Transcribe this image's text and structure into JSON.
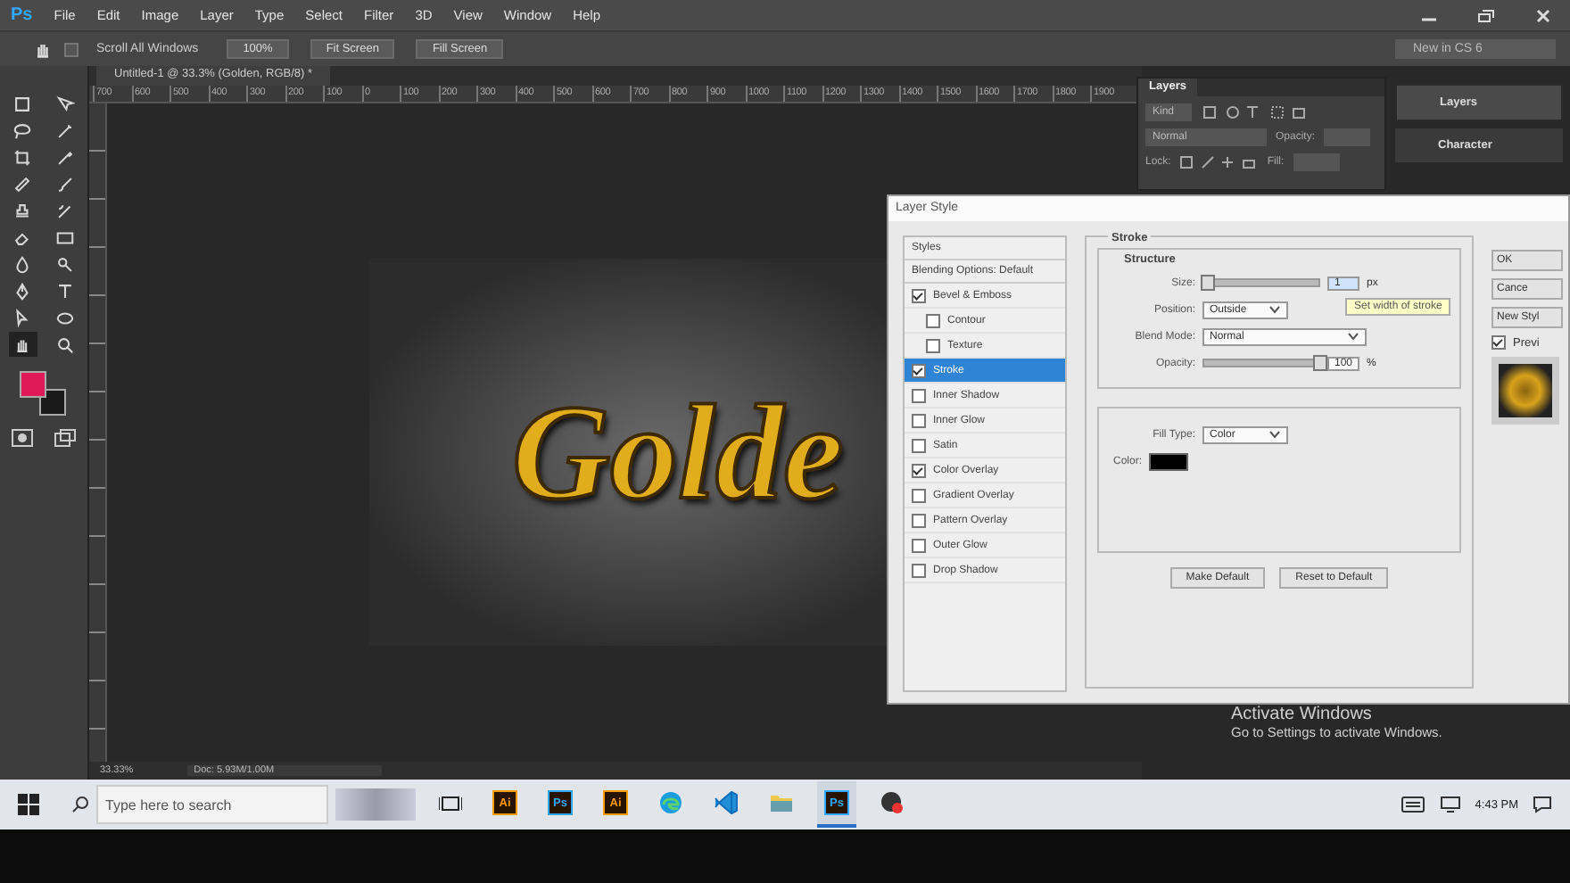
{
  "app": {
    "logo": "Ps"
  },
  "menu": [
    "File",
    "Edit",
    "Image",
    "Layer",
    "Type",
    "Select",
    "Filter",
    "3D",
    "View",
    "Window",
    "Help"
  ],
  "options_bar": {
    "scroll_all": {
      "label": "Scroll All Windows",
      "checked": false
    },
    "buttons": [
      "100%",
      "Fit Screen",
      "Fill Screen"
    ],
    "workspace": "New in CS 6"
  },
  "tools": [
    {
      "selected": false
    },
    {
      "selected": false
    },
    {
      "selected": false
    },
    {
      "selected": false
    },
    {
      "selected": false
    },
    {
      "selected": false
    },
    {
      "selected": false
    },
    {
      "selected": false
    },
    {
      "selected": false
    },
    {
      "selected": false
    },
    {
      "selected": false
    },
    {
      "selected": false
    },
    {
      "selected": false
    },
    {
      "selected": false
    },
    {
      "selected": false
    },
    {
      "selected": false
    },
    {
      "selected": false
    },
    {
      "selected": false
    },
    {
      "selected": true
    },
    {
      "selected": false
    }
  ],
  "swatches": [
    {
      "color": "#e0195a"
    },
    {
      "color": "#1a1a1a"
    }
  ],
  "document": {
    "tab": "Untitled-1 @ 33.3% (Golden, RGB/8) *",
    "ruler": [
      "700",
      "600",
      "500",
      "400",
      "300",
      "200",
      "100",
      "0",
      "100",
      "200",
      "300",
      "400",
      "500",
      "600",
      "700",
      "800",
      "900",
      "1000",
      "1100",
      "1200",
      "1300",
      "1400",
      "1500",
      "1600",
      "1700",
      "1800",
      "1900"
    ],
    "canvas_text": "Golde",
    "zoom": "33.33%",
    "doc_info": "Doc: 5.93M/1.00M"
  },
  "layers_panel": {
    "tab": "Layers",
    "filter": "Kind",
    "blend_mode": "Normal",
    "opacity_label": "Opacity:",
    "lock_label": "Lock:",
    "fill_label": "Fill:"
  },
  "dock": [
    {
      "label": "Layers",
      "selected": true
    },
    {
      "label": "Character",
      "selected": false
    }
  ],
  "dialog": {
    "title": "Layer Style",
    "styles_header": "Styles",
    "blending": "Blending Options: Default",
    "effects": [
      {
        "label": "Bevel & Emboss",
        "checked": true,
        "selected": false,
        "children": [
          {
            "label": "Contour",
            "checked": false,
            "selected": false
          },
          {
            "label": "Texture",
            "checked": false,
            "selected": false
          }
        ]
      },
      {
        "label": "Stroke",
        "checked": true,
        "selected": true
      },
      {
        "label": "Inner Shadow",
        "checked": false,
        "selected": false
      },
      {
        "label": "Inner Glow",
        "checked": false,
        "selected": false
      },
      {
        "label": "Satin",
        "checked": false,
        "selected": false
      },
      {
        "label": "Color Overlay",
        "checked": true,
        "selected": false
      },
      {
        "label": "Gradient Overlay",
        "checked": false,
        "selected": false
      },
      {
        "label": "Pattern Overlay",
        "checked": false,
        "selected": false
      },
      {
        "label": "Outer Glow",
        "checked": false,
        "selected": false
      },
      {
        "label": "Drop Shadow",
        "checked": false,
        "selected": false
      }
    ],
    "group_title": "Stroke",
    "structure_title": "Structure",
    "size": {
      "label": "Size:",
      "level": 0.02,
      "value": "1",
      "unit": "px"
    },
    "position": {
      "label": "Position:",
      "value": "Outside"
    },
    "blend_mode": {
      "label": "Blend Mode:",
      "value": "Normal"
    },
    "opacity": {
      "label": "Opacity:",
      "level": 1,
      "value": "100",
      "unit": "%"
    },
    "tooltip": "Set width of stroke",
    "fill_type": {
      "label": "Fill Type:",
      "value": "Color"
    },
    "color": {
      "label": "Color:",
      "color": "#000000"
    },
    "buttons": [
      "Make Default",
      "Reset to Default"
    ],
    "side_buttons": [
      "OK",
      "Cance",
      "New Styl"
    ],
    "preview": {
      "label": "Previ",
      "checked": true
    }
  },
  "taskbar": {
    "search_placeholder": "Type here to search",
    "apps": [
      {
        "kind": "task-view",
        "active": false
      },
      {
        "kind": "logo",
        "label": "Ai",
        "color": "#ff9a00",
        "active": false
      },
      {
        "kind": "logo",
        "label": "Ps",
        "color": "#31a8ff",
        "active": false
      },
      {
        "kind": "logo",
        "label": "Ai",
        "color": "#ff9a00",
        "active": false
      },
      {
        "kind": "edge",
        "active": false
      },
      {
        "kind": "code",
        "active": false
      },
      {
        "kind": "folder",
        "active": false
      },
      {
        "kind": "logo",
        "label": "Ps",
        "color": "#31a8ff",
        "active": true
      },
      {
        "kind": "record",
        "active": false
      }
    ],
    "time": "4:43 PM"
  },
  "activation": {
    "title": "Activate Windows",
    "text": "Go to Settings to activate Windows."
  }
}
